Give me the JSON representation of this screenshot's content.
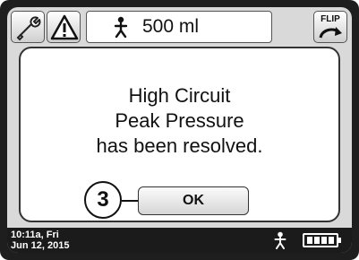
{
  "topbar": {
    "tools_icon": "wrench-icon",
    "alarm_icon": "alarm-warning-icon",
    "patient_icon": "person-icon",
    "volume": "500 ml",
    "flip_label": "FLIP",
    "flip_icon": "flip-arrow-icon"
  },
  "dialog": {
    "message_line1": "High Circuit",
    "message_line2": "Peak Pressure",
    "message_line3": "has been resolved.",
    "ok_label": "OK",
    "callout_number": "3"
  },
  "statusbar": {
    "time": "10:11a, Fri",
    "date": "Jun 12, 2015",
    "patient_icon": "person-icon",
    "battery_icon": "battery-icon"
  }
}
